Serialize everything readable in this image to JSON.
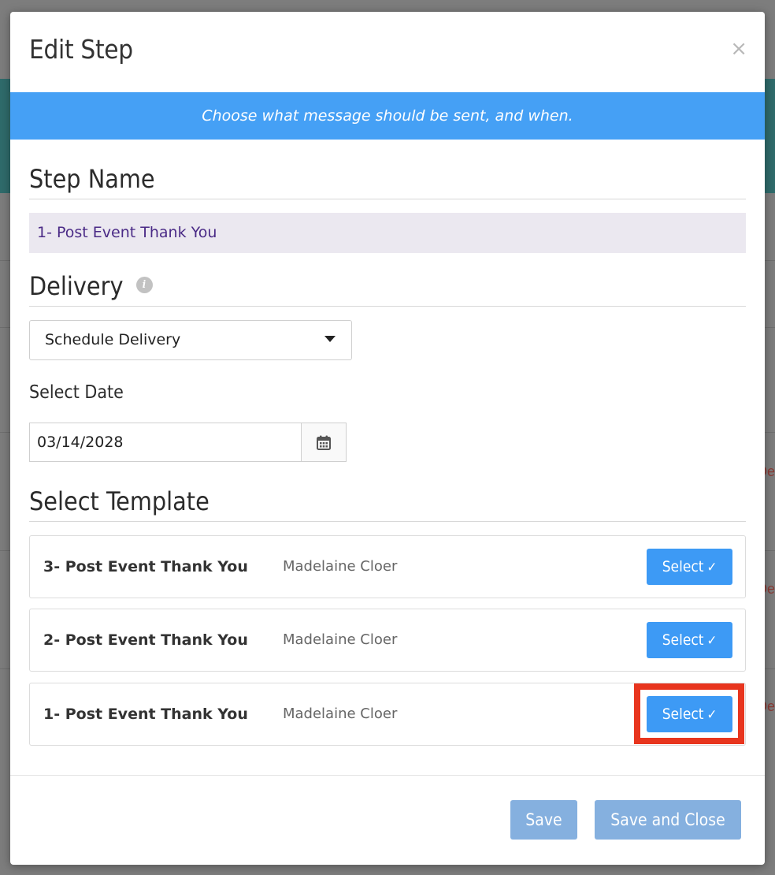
{
  "modal": {
    "title": "Edit Step",
    "close_glyph": "×",
    "banner_text": "Choose what message should be sent, and when."
  },
  "step_name": {
    "heading": "Step Name",
    "value": "1- Post Event Thank You"
  },
  "delivery": {
    "heading": "Delivery",
    "info_glyph": "i",
    "selected": "Schedule Delivery"
  },
  "date": {
    "label": "Select Date",
    "value": "03/14/2028"
  },
  "template": {
    "heading": "Select Template",
    "select_label": "Select",
    "check_glyph": "✓",
    "rows": [
      {
        "name": "3- Post Event Thank You",
        "author": "Madelaine Cloer"
      },
      {
        "name": "2- Post Event Thank You",
        "author": "Madelaine Cloer"
      },
      {
        "name": "1- Post Event Thank You",
        "author": "Madelaine Cloer"
      }
    ]
  },
  "footer": {
    "save_label": "Save",
    "save_close_label": "Save and Close"
  },
  "background": {
    "fragment_text": "De"
  },
  "colors": {
    "accent": "#45a0f5",
    "button": "#3d9af5",
    "disabled_button": "#85b0df",
    "highlight": "#e8351e"
  }
}
